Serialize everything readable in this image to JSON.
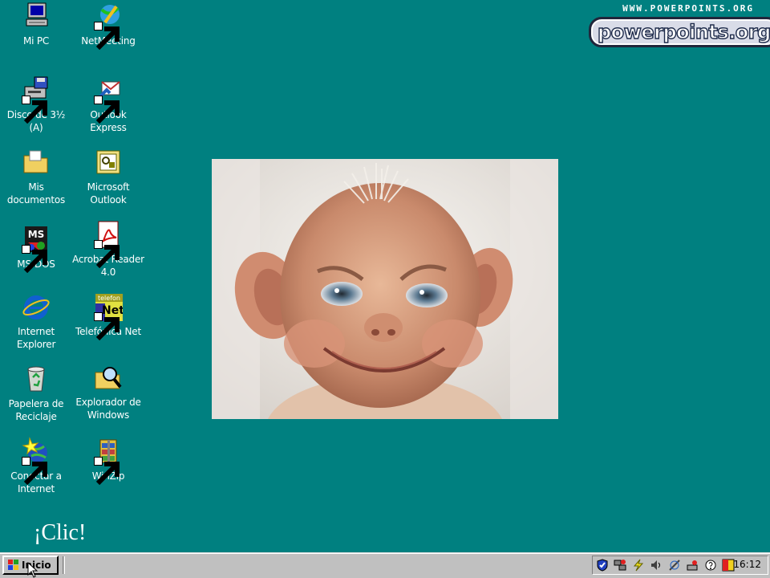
{
  "desktop": {
    "icons": [
      {
        "id": "mi-pc",
        "label": "Mi PC"
      },
      {
        "id": "netmeeting",
        "label": "NetMeeting"
      },
      {
        "id": "disco",
        "label": "Disco de 3½ (A)"
      },
      {
        "id": "outlook-express",
        "label": "Outlook Express"
      },
      {
        "id": "mis-documentos",
        "label": "Mis documentos"
      },
      {
        "id": "microsoft-outlook",
        "label": "Microsoft Outlook"
      },
      {
        "id": "ms-dos",
        "label": "MS-DOS"
      },
      {
        "id": "acrobat",
        "label": "Acrobat Reader 4.0"
      },
      {
        "id": "internet-explorer",
        "label": "Internet Explorer"
      },
      {
        "id": "telefonica",
        "label": "Telefónica Net"
      },
      {
        "id": "papelera",
        "label": "Papelera de Reciclaje"
      },
      {
        "id": "explorador",
        "label": "Explorador de Windows"
      },
      {
        "id": "conectar",
        "label": "Conectar a Internet"
      },
      {
        "id": "winzip",
        "label": "WinZip"
      }
    ],
    "icon_glyph_text": {
      "ms_dos": "MS",
      "telefonica_top": "telefon",
      "telefonica_net": "Net"
    }
  },
  "branding": {
    "url": "WWW.POWERPOINTS.ORG",
    "logo": "powerpoints.org"
  },
  "caption": "¡Clic!",
  "taskbar": {
    "start_label": "Inicio",
    "clock": "16:12",
    "tray_icons": [
      "shield-icon",
      "network-icon",
      "lightning-icon",
      "speaker-icon",
      "antenna-icon",
      "scanner-icon",
      "help-icon",
      "zonealarm-icon"
    ]
  },
  "colors": {
    "desktop": "#008080",
    "taskbar": "#c0c0c0"
  }
}
